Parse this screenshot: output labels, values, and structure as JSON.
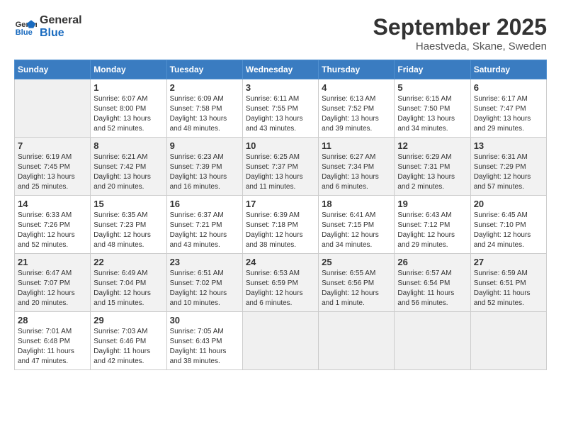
{
  "logo": {
    "line1": "General",
    "line2": "Blue"
  },
  "title": "September 2025",
  "subtitle": "Haestveda, Skane, Sweden",
  "days_header": [
    "Sunday",
    "Monday",
    "Tuesday",
    "Wednesday",
    "Thursday",
    "Friday",
    "Saturday"
  ],
  "weeks": [
    [
      {
        "day": "",
        "info": ""
      },
      {
        "day": "1",
        "info": "Sunrise: 6:07 AM\nSunset: 8:00 PM\nDaylight: 13 hours\nand 52 minutes."
      },
      {
        "day": "2",
        "info": "Sunrise: 6:09 AM\nSunset: 7:58 PM\nDaylight: 13 hours\nand 48 minutes."
      },
      {
        "day": "3",
        "info": "Sunrise: 6:11 AM\nSunset: 7:55 PM\nDaylight: 13 hours\nand 43 minutes."
      },
      {
        "day": "4",
        "info": "Sunrise: 6:13 AM\nSunset: 7:52 PM\nDaylight: 13 hours\nand 39 minutes."
      },
      {
        "day": "5",
        "info": "Sunrise: 6:15 AM\nSunset: 7:50 PM\nDaylight: 13 hours\nand 34 minutes."
      },
      {
        "day": "6",
        "info": "Sunrise: 6:17 AM\nSunset: 7:47 PM\nDaylight: 13 hours\nand 29 minutes."
      }
    ],
    [
      {
        "day": "7",
        "info": "Sunrise: 6:19 AM\nSunset: 7:45 PM\nDaylight: 13 hours\nand 25 minutes."
      },
      {
        "day": "8",
        "info": "Sunrise: 6:21 AM\nSunset: 7:42 PM\nDaylight: 13 hours\nand 20 minutes."
      },
      {
        "day": "9",
        "info": "Sunrise: 6:23 AM\nSunset: 7:39 PM\nDaylight: 13 hours\nand 16 minutes."
      },
      {
        "day": "10",
        "info": "Sunrise: 6:25 AM\nSunset: 7:37 PM\nDaylight: 13 hours\nand 11 minutes."
      },
      {
        "day": "11",
        "info": "Sunrise: 6:27 AM\nSunset: 7:34 PM\nDaylight: 13 hours\nand 6 minutes."
      },
      {
        "day": "12",
        "info": "Sunrise: 6:29 AM\nSunset: 7:31 PM\nDaylight: 13 hours\nand 2 minutes."
      },
      {
        "day": "13",
        "info": "Sunrise: 6:31 AM\nSunset: 7:29 PM\nDaylight: 12 hours\nand 57 minutes."
      }
    ],
    [
      {
        "day": "14",
        "info": "Sunrise: 6:33 AM\nSunset: 7:26 PM\nDaylight: 12 hours\nand 52 minutes."
      },
      {
        "day": "15",
        "info": "Sunrise: 6:35 AM\nSunset: 7:23 PM\nDaylight: 12 hours\nand 48 minutes."
      },
      {
        "day": "16",
        "info": "Sunrise: 6:37 AM\nSunset: 7:21 PM\nDaylight: 12 hours\nand 43 minutes."
      },
      {
        "day": "17",
        "info": "Sunrise: 6:39 AM\nSunset: 7:18 PM\nDaylight: 12 hours\nand 38 minutes."
      },
      {
        "day": "18",
        "info": "Sunrise: 6:41 AM\nSunset: 7:15 PM\nDaylight: 12 hours\nand 34 minutes."
      },
      {
        "day": "19",
        "info": "Sunrise: 6:43 AM\nSunset: 7:12 PM\nDaylight: 12 hours\nand 29 minutes."
      },
      {
        "day": "20",
        "info": "Sunrise: 6:45 AM\nSunset: 7:10 PM\nDaylight: 12 hours\nand 24 minutes."
      }
    ],
    [
      {
        "day": "21",
        "info": "Sunrise: 6:47 AM\nSunset: 7:07 PM\nDaylight: 12 hours\nand 20 minutes."
      },
      {
        "day": "22",
        "info": "Sunrise: 6:49 AM\nSunset: 7:04 PM\nDaylight: 12 hours\nand 15 minutes."
      },
      {
        "day": "23",
        "info": "Sunrise: 6:51 AM\nSunset: 7:02 PM\nDaylight: 12 hours\nand 10 minutes."
      },
      {
        "day": "24",
        "info": "Sunrise: 6:53 AM\nSunset: 6:59 PM\nDaylight: 12 hours\nand 6 minutes."
      },
      {
        "day": "25",
        "info": "Sunrise: 6:55 AM\nSunset: 6:56 PM\nDaylight: 12 hours\nand 1 minute."
      },
      {
        "day": "26",
        "info": "Sunrise: 6:57 AM\nSunset: 6:54 PM\nDaylight: 11 hours\nand 56 minutes."
      },
      {
        "day": "27",
        "info": "Sunrise: 6:59 AM\nSunset: 6:51 PM\nDaylight: 11 hours\nand 52 minutes."
      }
    ],
    [
      {
        "day": "28",
        "info": "Sunrise: 7:01 AM\nSunset: 6:48 PM\nDaylight: 11 hours\nand 47 minutes."
      },
      {
        "day": "29",
        "info": "Sunrise: 7:03 AM\nSunset: 6:46 PM\nDaylight: 11 hours\nand 42 minutes."
      },
      {
        "day": "30",
        "info": "Sunrise: 7:05 AM\nSunset: 6:43 PM\nDaylight: 11 hours\nand 38 minutes."
      },
      {
        "day": "",
        "info": ""
      },
      {
        "day": "",
        "info": ""
      },
      {
        "day": "",
        "info": ""
      },
      {
        "day": "",
        "info": ""
      }
    ]
  ]
}
